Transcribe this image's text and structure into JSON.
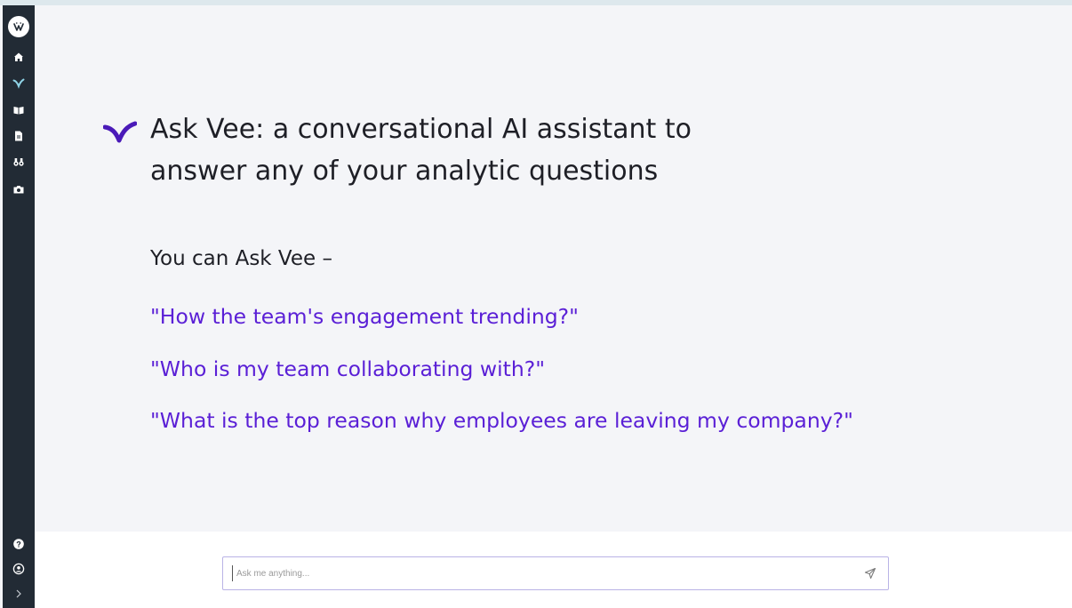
{
  "hero": {
    "title_line1": "Ask Vee: a conversational AI assistant to",
    "title_line2": "answer any of your analytic questions",
    "intro": "You can Ask Vee –",
    "examples": [
      "\"How the team's engagement trending?\"",
      "\"Who is my team collaborating with?\"",
      "\"What is the top reason why employees are leaving my company?\""
    ]
  },
  "chat": {
    "placeholder": "Ask me anything..."
  },
  "icons": {
    "logo": "brand-logo-icon",
    "nav": [
      "home-icon",
      "vee-icon",
      "book-icon",
      "document-icon",
      "binoculars-icon",
      "camera-icon"
    ],
    "bottom": [
      "help-icon",
      "user-profile-icon",
      "expand-chevron-icon"
    ],
    "send": "send-icon",
    "hero": "vee-mark-icon"
  },
  "colors": {
    "sidebar": "#222b35",
    "accent": "#5a1fd6",
    "text": "#1e1f26",
    "background": "#f4f5f8"
  }
}
